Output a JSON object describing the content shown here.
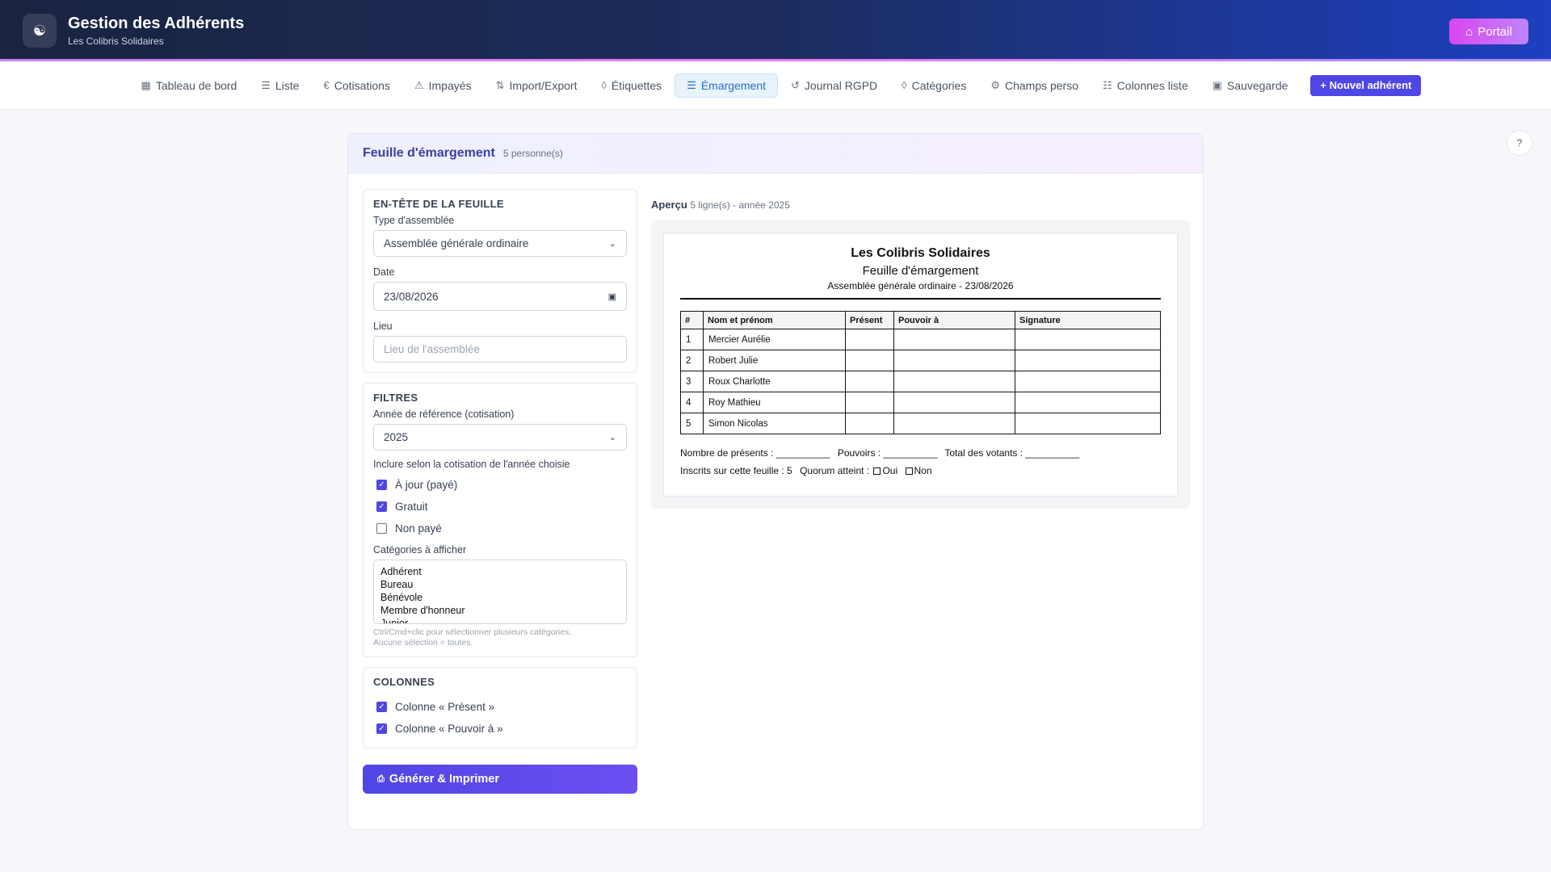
{
  "header": {
    "title": "Gestion des Adhérents",
    "subtitle": "Les Colibris Solidaires",
    "portal_label": "Portail"
  },
  "nav": {
    "items": [
      {
        "label": "Tableau de bord",
        "icon": "grid-icon"
      },
      {
        "label": "Liste",
        "icon": "list-icon"
      },
      {
        "label": "Cotisations",
        "icon": "euro-icon"
      },
      {
        "label": "Impayés",
        "icon": "warning-icon"
      },
      {
        "label": "Import/Export",
        "icon": "file-icon"
      },
      {
        "label": "Étiquettes",
        "icon": "tag-icon"
      },
      {
        "label": "Émargement",
        "icon": "list-icon"
      },
      {
        "label": "Journal RGPD",
        "icon": "history-icon"
      },
      {
        "label": "Catégories",
        "icon": "tag-icon"
      },
      {
        "label": "Champs perso",
        "icon": "gear-icon"
      },
      {
        "label": "Colonnes liste",
        "icon": "columns-icon"
      },
      {
        "label": "Sauvegarde",
        "icon": "save-icon"
      }
    ],
    "active": "Émargement",
    "new_member_label": "+ Nouvel adhérent"
  },
  "help_label": "?",
  "card": {
    "title": "Feuille d'émargement",
    "count": "5 personne(s)"
  },
  "sheet_header": {
    "title": "EN-TÊTE DE LA FEUILLE",
    "type_label": "Type d'assemblée",
    "type_value": "Assemblée générale ordinaire",
    "date_label": "Date",
    "date_value": "23/08/2026",
    "place_label": "Lieu",
    "place_placeholder": "Lieu de l'assemblée"
  },
  "filters": {
    "title": "FILTRES",
    "year_label": "Année de référence (cotisation)",
    "year_value": "2025",
    "include_label": "Inclure selon la cotisation de l'année choisie",
    "options": [
      {
        "label": "À jour (payé)",
        "checked": true
      },
      {
        "label": "Gratuit",
        "checked": true
      },
      {
        "label": "Non payé",
        "checked": false
      }
    ],
    "categories_label": "Catégories à afficher",
    "categories": [
      "Adhérent",
      "Bureau",
      "Bénévole",
      "Membre d'honneur",
      "Junior"
    ],
    "hint_line1": "Ctrl/Cmd+clic pour sélectionner plusieurs catégories.",
    "hint_line2": "Aucune sélection = toutes."
  },
  "columns": {
    "title": "COLONNES",
    "options": [
      {
        "label": "Colonne « Présent »",
        "checked": true
      },
      {
        "label": "Colonne « Pouvoir à »",
        "checked": true
      }
    ]
  },
  "generate_label": "Générer & Imprimer",
  "preview": {
    "title": "Aperçu",
    "info": "5 ligne(s) - année 2025",
    "org": "Les Colibris Solidaires",
    "sheet_title": "Feuille d'émargement",
    "sheet_sub": "Assemblée générale ordinaire - 23/08/2026",
    "columns": [
      "#",
      "Nom et prénom",
      "Présent",
      "Pouvoir à",
      "Signature"
    ],
    "rows": [
      {
        "num": "1",
        "name": "Mercier Aurélie"
      },
      {
        "num": "2",
        "name": "Robert Julie"
      },
      {
        "num": "3",
        "name": "Roux Charlotte"
      },
      {
        "num": "4",
        "name": "Roy Mathieu"
      },
      {
        "num": "5",
        "name": "Simon Nicolas"
      }
    ],
    "present_count": "Nombre de présents : __________",
    "proxies": "Pouvoirs : __________",
    "voters": "Total des votants : __________",
    "registered": "Inscrits sur cette feuille : 5",
    "quorum": "Quorum atteint :",
    "yes": "Oui",
    "no": "Non"
  }
}
